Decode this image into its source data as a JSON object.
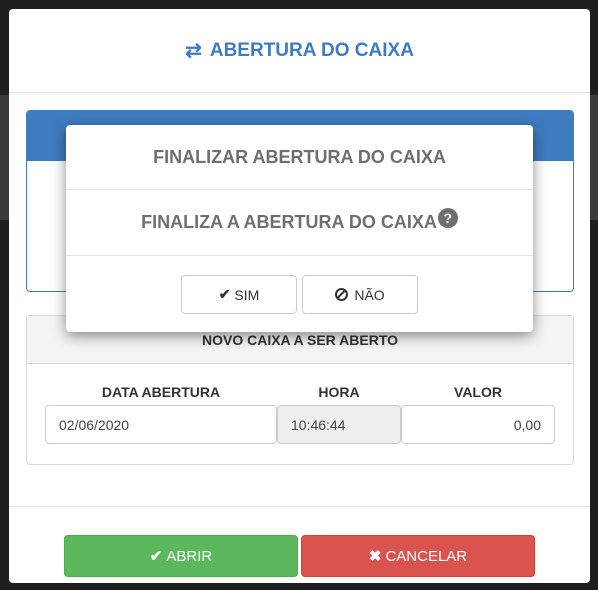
{
  "modal": {
    "title": "ABERTURA DO CAIXA",
    "title_icon": "exchange-arrows-icon"
  },
  "panel": {
    "heading": "NOVO CAIXA A SER ABERTO",
    "fields": [
      {
        "label": "DATA ABERTURA",
        "value": "02/06/2020"
      },
      {
        "label": "HORA",
        "value": "10:46:44"
      },
      {
        "label": "VALOR",
        "value": "0,00"
      }
    ]
  },
  "footer": {
    "abrir_label": "ABRIR",
    "cancelar_label": "CANCELAR"
  },
  "confirm": {
    "title": "FINALIZAR ABERTURA DO CAIXA",
    "message": "FINALIZA A ABERTURA DO CAIXA",
    "help_glyph": "?",
    "yes_label": "SIM",
    "no_label": "NÃO"
  },
  "colors": {
    "accent": "#3f7bbf",
    "success": "#5cb85c",
    "danger": "#d9534f"
  }
}
